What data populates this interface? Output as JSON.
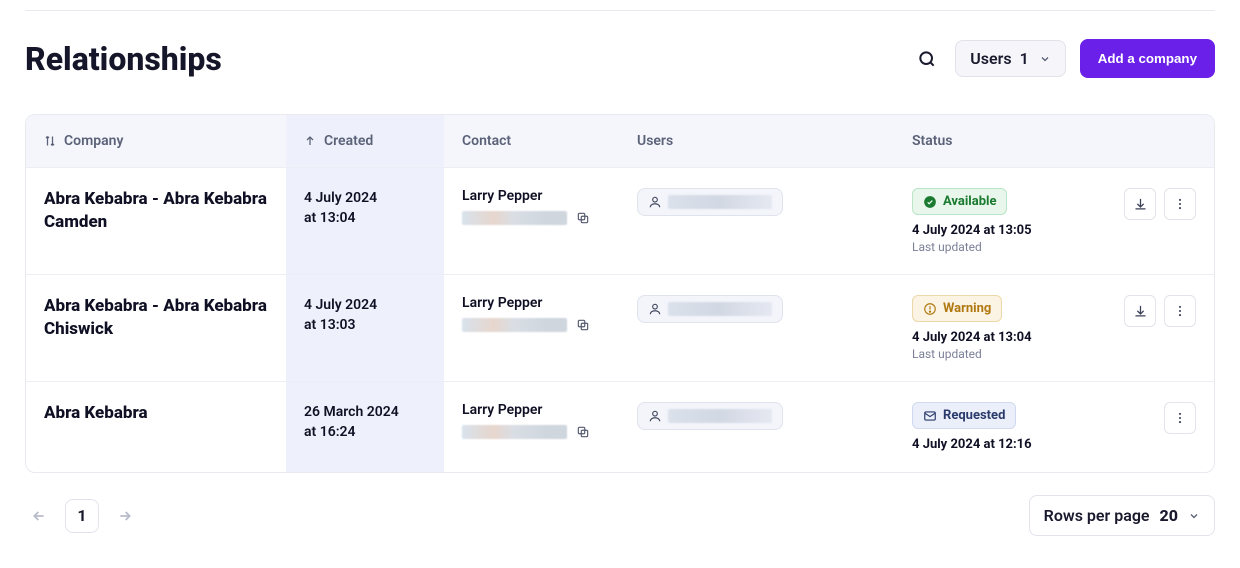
{
  "header": {
    "title": "Relationships",
    "usersFilter": {
      "label": "Users",
      "count": "1"
    },
    "addCompanyLabel": "Add a company"
  },
  "columns": {
    "company": "Company",
    "created": "Created",
    "contact": "Contact",
    "users": "Users",
    "status": "Status"
  },
  "rows": [
    {
      "company": "Abra Kebabra - Abra Kebabra Camden",
      "created": {
        "date": "4 July 2024",
        "time": "at 13:04"
      },
      "contact": "Larry Pepper",
      "status": {
        "kind": "available",
        "label": "Available",
        "timestamp": "4 July 2024 at 13:05",
        "sub": "Last updated"
      },
      "hasDownload": true
    },
    {
      "company": "Abra Kebabra - Abra Kebabra Chiswick",
      "created": {
        "date": "4 July 2024",
        "time": "at 13:03"
      },
      "contact": "Larry Pepper",
      "status": {
        "kind": "warning",
        "label": "Warning",
        "timestamp": "4 July 2024 at 13:04",
        "sub": "Last updated"
      },
      "hasDownload": true
    },
    {
      "company": "Abra Kebabra",
      "created": {
        "date": "26 March 2024",
        "time": "at 16:24"
      },
      "contact": "Larry Pepper",
      "status": {
        "kind": "requested",
        "label": "Requested",
        "timestamp": "4 July 2024 at 12:16",
        "sub": ""
      },
      "hasDownload": false
    }
  ],
  "pagination": {
    "current": "1",
    "rowsPerPageLabel": "Rows per page",
    "rowsPerPage": "20"
  }
}
